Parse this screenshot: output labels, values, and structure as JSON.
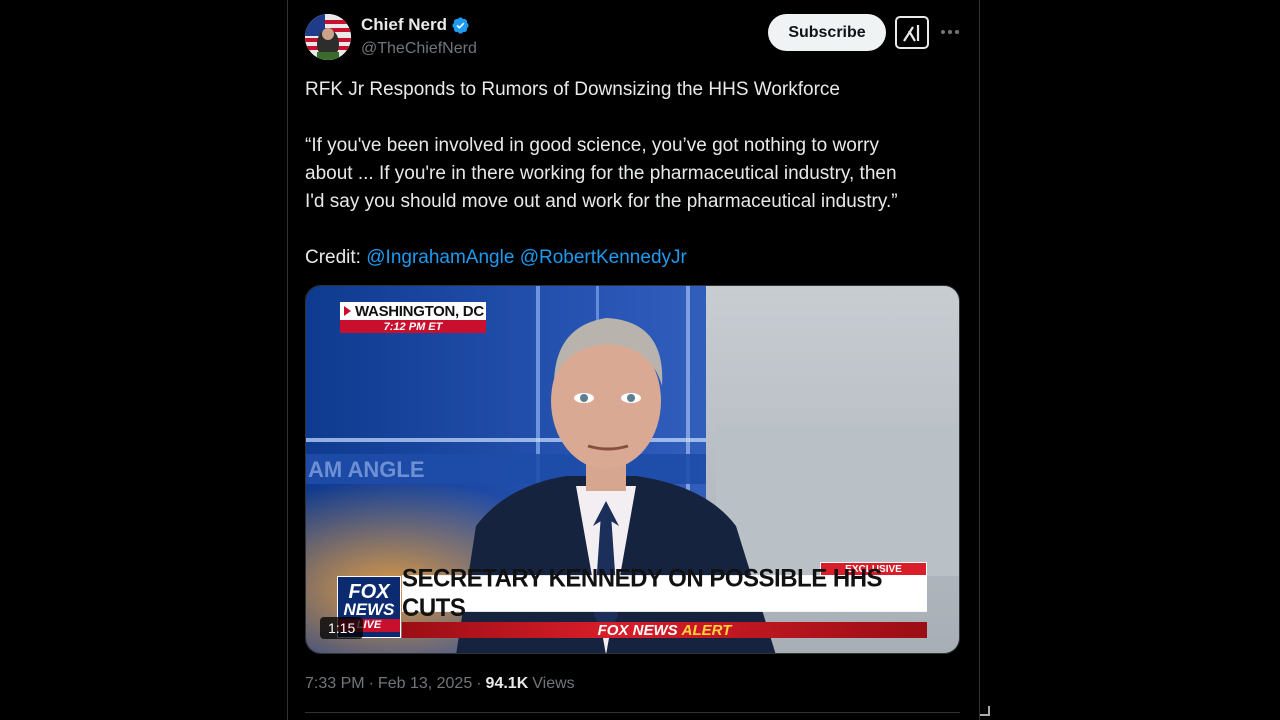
{
  "author": {
    "display_name": "Chief Nerd",
    "handle": "@TheChiefNerd",
    "verified": true,
    "avatar_icon": "avatar-image"
  },
  "actions": {
    "subscribe_label": "Subscribe",
    "grok_icon": "grok-icon",
    "more_icon": "more-icon"
  },
  "tweet": {
    "title_line": "RFK Jr Responds to Rumors of Downsizing the HHS Workforce",
    "quote_line_1": "“If you've been involved in good science, you’ve got nothing to worry",
    "quote_line_2": "about ... If you're in there working for the pharmaceutical industry, then",
    "quote_line_3": "I'd say you should move out and work for the pharmaceutical industry.”",
    "credit_label": "Credit: ",
    "mention_1": "@IngrahamAngle",
    "mention_2": "@RobertKennedyJr"
  },
  "video": {
    "location": "WASHINGTON, DC",
    "time": "7:12 PM ET",
    "exclusive": "EXCLUSIVE",
    "headline": "SECRETARY KENNEDY ON POSSIBLE HHS CUTS",
    "alert_brand": "FOX NEWS",
    "alert_word": "ALERT",
    "logo_fox": "FOX",
    "logo_news": "NEWS",
    "logo_live": "LIVE",
    "backdrop_text": "AM ANGLE",
    "duration": "1:15"
  },
  "meta": {
    "time": "7:33 PM",
    "separator": "·",
    "date": "Feb 13, 2025",
    "views_count": "94.1K",
    "views_label": "Views"
  },
  "colors": {
    "accent": "#1d9bf0",
    "background": "#000000",
    "fox_red": "#c8102e"
  }
}
